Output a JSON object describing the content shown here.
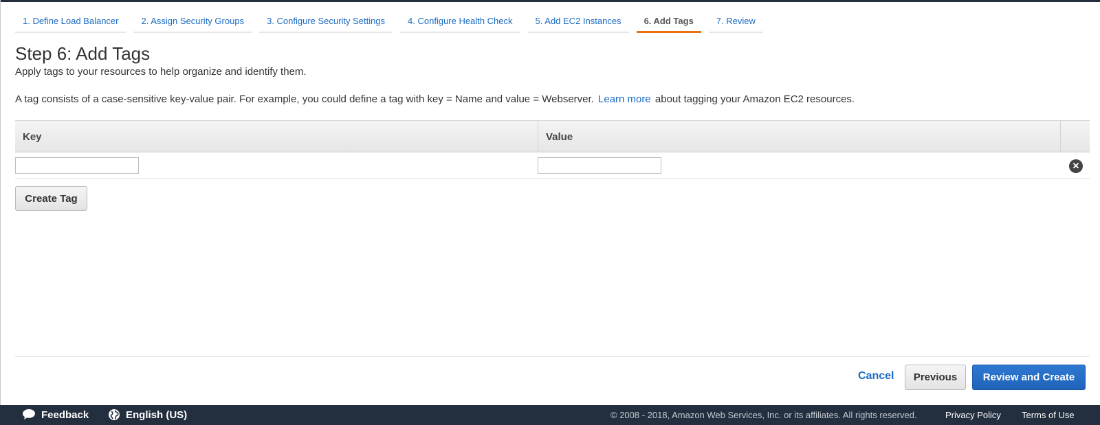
{
  "wizard": {
    "tabs": [
      {
        "label": "1. Define Load Balancer"
      },
      {
        "label": "2. Assign Security Groups"
      },
      {
        "label": "3. Configure Security Settings"
      },
      {
        "label": "4. Configure Health Check"
      },
      {
        "label": "5. Add EC2 Instances"
      },
      {
        "label": "6. Add Tags",
        "active": true
      },
      {
        "label": "7. Review"
      }
    ]
  },
  "page": {
    "title": "Step 6: Add Tags",
    "subtitle": "Apply tags to your resources to help organize and identify them.",
    "description_before": "A tag consists of a case-sensitive key-value pair. For example, you could define a tag with key = Name and value = Webserver.",
    "learn_more": "Learn more",
    "description_after": "about tagging your Amazon EC2 resources."
  },
  "tags_table": {
    "headers": {
      "key": "Key",
      "value": "Value"
    },
    "rows": [
      {
        "key": "",
        "value": "",
        "remove_icon": "close-circle-icon"
      }
    ]
  },
  "buttons": {
    "create_tag": "Create Tag",
    "cancel": "Cancel",
    "previous": "Previous",
    "review_and_create": "Review and Create"
  },
  "footer": {
    "feedback": "Feedback",
    "feedback_icon": "speech-bubble-icon",
    "language": "English (US)",
    "language_icon": "globe-icon",
    "copyright": "© 2008 - 2018, Amazon Web Services, Inc. or its affiliates. All rights reserved.",
    "privacy": "Privacy Policy",
    "terms": "Terms of Use"
  },
  "colors": {
    "link": "#1a6bc4",
    "active_tab_underline": "#ec7211",
    "primary_button": "#1f63b9",
    "footer_bg": "#232f3e"
  }
}
